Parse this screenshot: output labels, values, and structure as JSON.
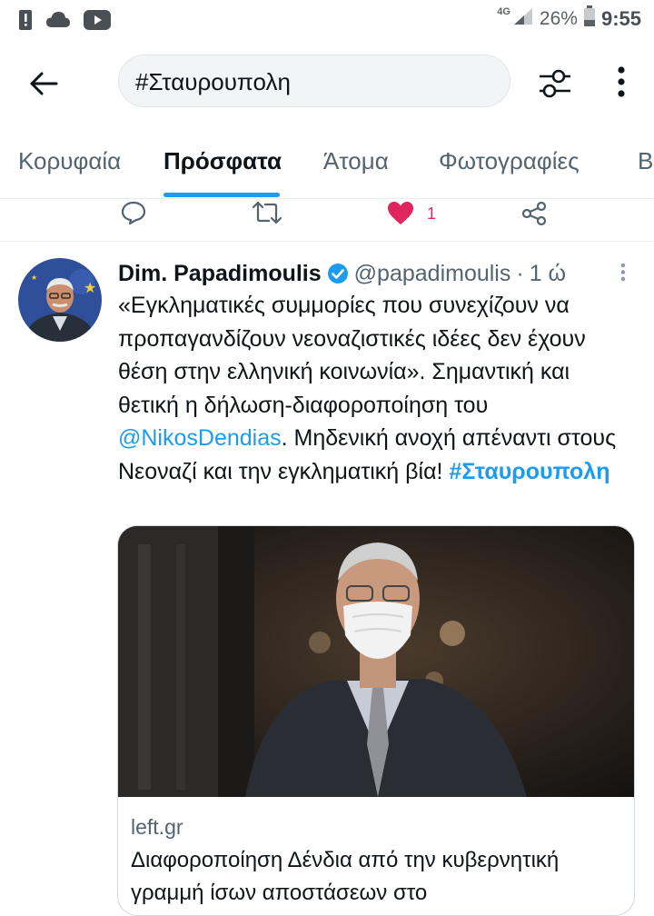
{
  "status_bar": {
    "network": "4G",
    "battery": "26%",
    "time": "9:55",
    "icons": [
      "alert-icon",
      "cloud-icon",
      "youtube-icon",
      "signal-icon",
      "battery-icon"
    ]
  },
  "header": {
    "search_value": "#Σταυρουπολη",
    "back_icon": "arrow-left-icon",
    "filter_icon": "filter-sliders-icon",
    "more_icon": "more-vertical-icon"
  },
  "tabs": [
    {
      "label": "Κορυφαία",
      "active": false
    },
    {
      "label": "Πρόσφατα",
      "active": true
    },
    {
      "label": "Άτομα",
      "active": false
    },
    {
      "label": "Φωτογραφίες",
      "active": false
    },
    {
      "label": "Β",
      "active": false
    }
  ],
  "prev_tweet_actions": {
    "like_count": "1"
  },
  "tweet": {
    "name": "Dim. Papadimoulis",
    "handle": "@papadimoulis",
    "separator": "·",
    "time": "1 ώ",
    "text_part1": "«Εγκληματικές συμμορίες που συνεχίζουν να προπαγανδίζουν νεοναζιστικές ιδέες δεν έχουν θέση στην ελληνική κοινωνία». Σημαντική και θετική η δήλωση-διαφοροποίηση του ",
    "mention": "@NikosDendias",
    "text_part2": ". Μηδενική ανοχή απέναντι στους Νεοναζί και την εγκληματική βία! ",
    "hashtag": "#Σταυρουπολη",
    "card": {
      "domain": "left.gr",
      "title": "Διαφοροποίηση Δένδια από την κυβερνητική γραμμή ίσων αποστάσεων στο"
    }
  },
  "colors": {
    "accent": "#1d9bf0",
    "like": "#e0245e",
    "text": "#0f1419",
    "secondary": "#536471"
  }
}
